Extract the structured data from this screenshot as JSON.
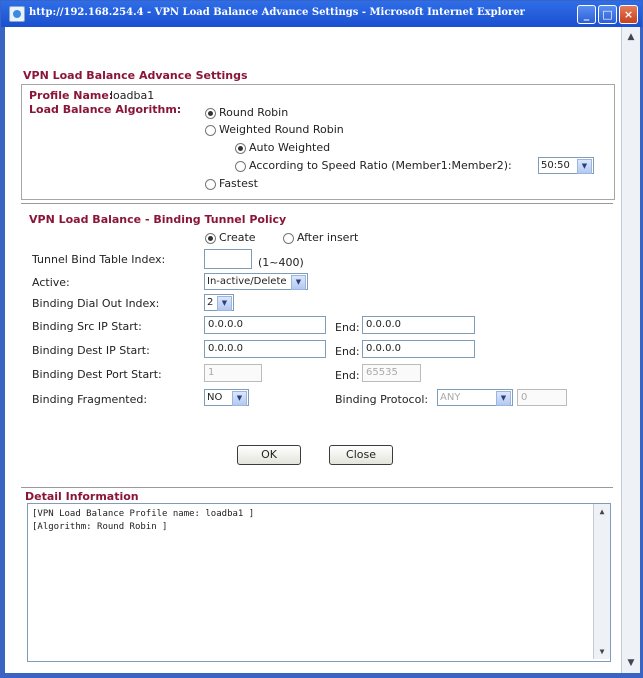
{
  "window": {
    "title": "http://192.168.254.4 - VPN Load Balance Advance Settings - Microsoft Internet Explorer",
    "minimize": "_",
    "maximize": "□",
    "close": "×"
  },
  "section1": {
    "title": "VPN Load Balance Advance Settings",
    "profile_label": "Profile Name:",
    "profile_value": "loadba1",
    "algorithm_label": "Load Balance Algorithm:",
    "opt_round_robin": "Round Robin",
    "opt_weighted": "Weighted Round Robin",
    "opt_auto_weighted": "Auto Weighted",
    "opt_speed_ratio": "According to Speed Ratio (Member1:Member2):",
    "speed_ratio_value": "50:50",
    "opt_fastest": "Fastest"
  },
  "section2": {
    "title": "VPN Load Balance - Binding Tunnel Policy",
    "opt_create": "Create",
    "opt_after_insert": "After insert",
    "tunnel_index_label": "Tunnel Bind Table Index:",
    "tunnel_index_value": "",
    "tunnel_index_hint": "(1~400)",
    "active_label": "Active:",
    "active_value": "In-active/Delete",
    "dialout_label": "Binding Dial Out Index:",
    "dialout_value": "2",
    "src_ip_label": "Binding Src IP Start:",
    "src_ip_start": "0.0.0.0",
    "src_ip_end_label": "End:",
    "src_ip_end": "0.0.0.0",
    "dest_ip_label": "Binding Dest IP Start:",
    "dest_ip_start": "0.0.0.0",
    "dest_ip_end_label": "End:",
    "dest_ip_end": "0.0.0.0",
    "dest_port_label": "Binding Dest Port Start:",
    "dest_port_start": "1",
    "dest_port_end_label": "End:",
    "dest_port_end": "65535",
    "frag_label": "Binding Fragmented:",
    "frag_value": "NO",
    "protocol_label": "Binding Protocol:",
    "protocol_value": "ANY",
    "protocol_num": "0"
  },
  "buttons": {
    "ok": "OK",
    "close": "Close"
  },
  "detail": {
    "title": "Detail Information",
    "lines": [
      "[VPN Load Balance Profile name: loadba1 ]",
      "[Algorithm: Round Robin ]"
    ]
  },
  "icons": {
    "dropdown": "▼",
    "scroll_up": "▲",
    "scroll_down": "▼"
  }
}
